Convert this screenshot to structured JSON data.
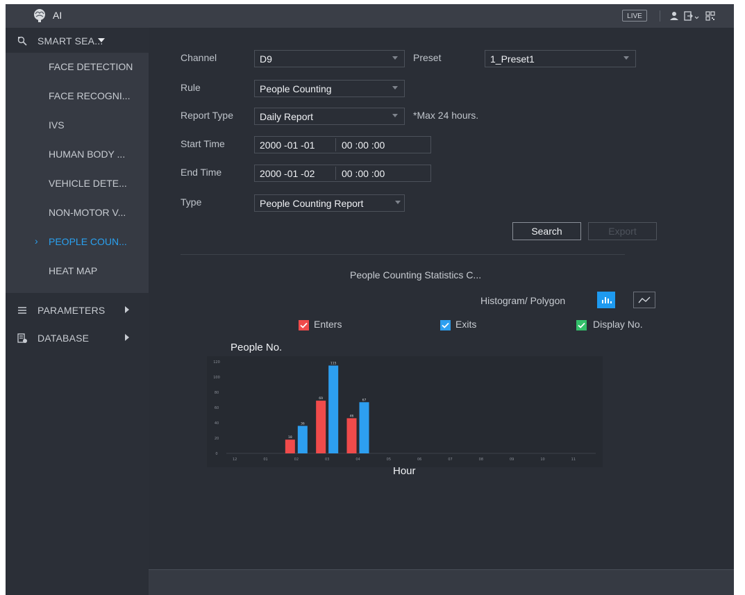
{
  "titlebar": {
    "title": "AI",
    "live_label": "LIVE"
  },
  "sidebar": {
    "smart_search": {
      "label": "SMART SEA..."
    },
    "items": [
      {
        "label": "FACE DETECTION"
      },
      {
        "label": "FACE RECOGNI..."
      },
      {
        "label": "IVS"
      },
      {
        "label": "HUMAN BODY ..."
      },
      {
        "label": "VEHICLE DETE..."
      },
      {
        "label": "NON-MOTOR V..."
      },
      {
        "label": "PEOPLE COUN...",
        "active": true
      },
      {
        "label": "HEAT MAP"
      }
    ],
    "parameters": {
      "label": "PARAMETERS"
    },
    "database": {
      "label": "DATABASE"
    }
  },
  "form": {
    "channel": {
      "label": "Channel",
      "value": "D9"
    },
    "preset": {
      "label": "Preset",
      "value": "1_Preset1"
    },
    "rule": {
      "label": "Rule",
      "value": "People Counting"
    },
    "report_type": {
      "label": "Report Type",
      "value": "Daily Report",
      "hint": "*Max 24 hours."
    },
    "start_time": {
      "label": "Start Time",
      "date": "2000 -01 -01",
      "time": "00 :00 :00"
    },
    "end_time": {
      "label": "End Time",
      "date": "2000 -01 -02",
      "time": "00 :00 :00"
    },
    "type": {
      "label": "Type",
      "value": "People Counting Report"
    },
    "search_label": "Search",
    "export_label": "Export"
  },
  "stats": {
    "title": "People Counting Statistics C...",
    "mode_label": "Histogram/ Polygon",
    "legend": {
      "enters": "Enters",
      "exits": "Exits",
      "display_no": "Display No."
    }
  },
  "colors": {
    "enters": "#f04b4b",
    "exits": "#2d9ff0",
    "display": "#33c06a",
    "accent": "#2aa1f0"
  },
  "icons": {
    "app": "ai-brain-icon",
    "user": "user-icon",
    "logout": "logout-icon",
    "qr": "qr-code-icon",
    "histogram": "histogram-icon",
    "polygon": "polyline-icon"
  },
  "chart_data": {
    "type": "bar",
    "ylabel": "People No.",
    "xlabel": "Hour",
    "categories": [
      "12",
      "01",
      "02",
      "03",
      "04",
      "05",
      "06",
      "07",
      "08",
      "09",
      "10",
      "11"
    ],
    "series": [
      {
        "name": "Enters",
        "values": [
          0,
          0,
          18,
          69,
          46,
          0,
          0,
          0,
          0,
          0,
          0,
          0
        ]
      },
      {
        "name": "Exits",
        "values": [
          0,
          0,
          36,
          115,
          67,
          0,
          0,
          0,
          0,
          0,
          0,
          0
        ]
      }
    ],
    "yticks": [
      0,
      20,
      40,
      60,
      80,
      100,
      120
    ],
    "ylim": [
      0,
      120
    ],
    "grid": false
  }
}
